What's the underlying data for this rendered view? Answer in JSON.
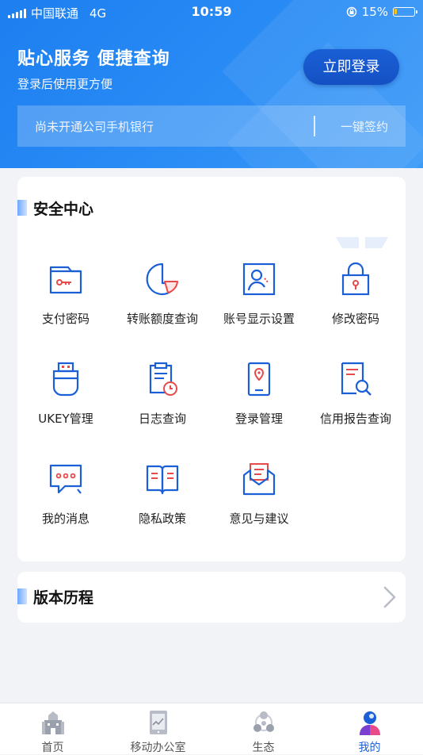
{
  "status_bar": {
    "carrier": "中国联通",
    "network": "4G",
    "time": "10:59",
    "battery": "15%",
    "battery_level": 0.15
  },
  "header": {
    "title": "贴心服务 便捷查询",
    "subtitle": "登录后使用更方便",
    "login_button": "立即登录",
    "sign_bar": {
      "text": "尚未开通公司手机银行",
      "action": "一键签约"
    }
  },
  "security_center": {
    "title": "安全中心",
    "items": [
      {
        "label": "支付密码",
        "icon": "key-card-icon"
      },
      {
        "label": "转账额度查询",
        "icon": "pie-chart-icon"
      },
      {
        "label": "账号显示设置",
        "icon": "user-profile-icon"
      },
      {
        "label": "修改密码",
        "icon": "lock-icon"
      },
      {
        "label": "UKEY管理",
        "icon": "usb-key-icon"
      },
      {
        "label": "日志查询",
        "icon": "clipboard-clock-icon"
      },
      {
        "label": "登录管理",
        "icon": "mobile-location-icon"
      },
      {
        "label": "信用报告查询",
        "icon": "report-search-icon"
      },
      {
        "label": "我的消息",
        "icon": "chat-bubble-icon"
      },
      {
        "label": "隐私政策",
        "icon": "open-book-icon"
      },
      {
        "label": "意见与建议",
        "icon": "envelope-icon"
      }
    ]
  },
  "version": {
    "title": "版本历程"
  },
  "tabbar": [
    {
      "label": "首页",
      "icon": "building-icon",
      "active": false
    },
    {
      "label": "移动办公室",
      "icon": "tablet-icon",
      "active": false
    },
    {
      "label": "生态",
      "icon": "network-icon",
      "active": false
    },
    {
      "label": "我的",
      "icon": "person-icon",
      "active": true
    }
  ],
  "colors": {
    "primary": "#1d7ff0",
    "icon_blue": "#1b5fd6",
    "icon_red": "#e84a4a",
    "active_tab": "#1b5fd6"
  }
}
